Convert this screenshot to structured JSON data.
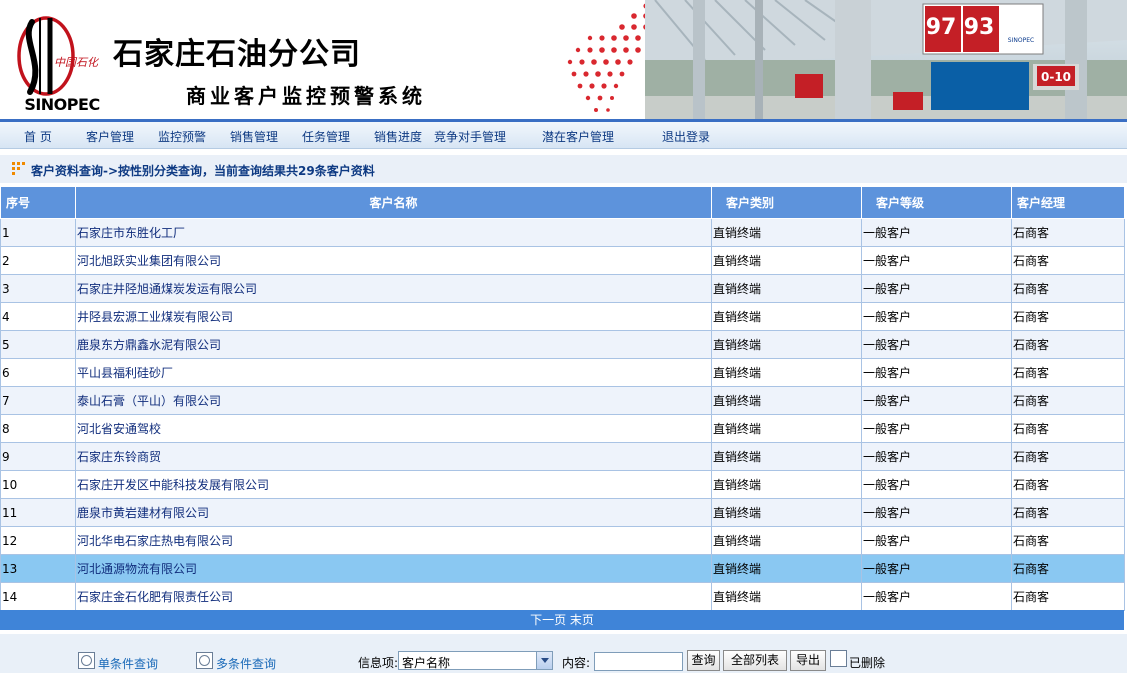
{
  "header": {
    "company_name": "石家庄石油分公司",
    "system_name": "商业客户监控预警系统",
    "logo_text": "中国石化",
    "logo_wordmark": "SINOPEC",
    "banner_price_1": "97",
    "banner_price_2": "93",
    "banner_brand": "SINOPEC",
    "banner_sign": "0-10"
  },
  "nav": {
    "items": [
      "首 页",
      "客户管理",
      "监控预警",
      "销售管理",
      "任务管理",
      "销售进度",
      "竞争对手管理",
      "潜在客户管理",
      "退出登录"
    ]
  },
  "breadcrumb": {
    "text": "客户资料查询->按性别分类查询，当前查询结果共29条客户资料"
  },
  "table": {
    "columns": [
      "序号",
      "客户名称",
      "客户类别",
      "客户等级",
      "客户经理"
    ],
    "rows": [
      [
        "1",
        "石家庄市东胜化工厂",
        "直销终端",
        "一般客户",
        "石商客"
      ],
      [
        "2",
        "河北旭跃实业集团有限公司",
        "直销终端",
        "一般客户",
        "石商客"
      ],
      [
        "3",
        "石家庄井陉旭通煤炭发运有限公司",
        "直销终端",
        "一般客户",
        "石商客"
      ],
      [
        "4",
        "井陉县宏源工业煤炭有限公司",
        "直销终端",
        "一般客户",
        "石商客"
      ],
      [
        "5",
        "鹿泉东方鼎鑫水泥有限公司",
        "直销终端",
        "一般客户",
        "石商客"
      ],
      [
        "6",
        "平山县福利硅砂厂",
        "直销终端",
        "一般客户",
        "石商客"
      ],
      [
        "7",
        "泰山石膏（平山）有限公司",
        "直销终端",
        "一般客户",
        "石商客"
      ],
      [
        "8",
        "河北省安通驾校",
        "直销终端",
        "一般客户",
        "石商客"
      ],
      [
        "9",
        "石家庄东铃商贸",
        "直销终端",
        "一般客户",
        "石商客"
      ],
      [
        "10",
        "石家庄开发区中能科技发展有限公司",
        "直销终端",
        "一般客户",
        "石商客"
      ],
      [
        "11",
        "鹿泉市黄岩建材有限公司",
        "直销终端",
        "一般客户",
        "石商客"
      ],
      [
        "12",
        "河北华电石家庄热电有限公司",
        "直销终端",
        "一般客户",
        "石商客"
      ],
      [
        "13",
        "河北通源物流有限公司",
        "直销终端",
        "一般客户",
        "石商客"
      ],
      [
        "14",
        "石家庄金石化肥有限责任公司",
        "直销终端",
        "一般客户",
        "石商客"
      ]
    ],
    "selected_row": 13
  },
  "pager": {
    "next_page": "下一页",
    "last_page": "末页"
  },
  "search": {
    "single_label": "单条件查询",
    "multi_label": "多条件查询",
    "field_label": "信息项:",
    "field_value": "客户名称",
    "content_label": "内容:",
    "content_value": "",
    "query_button": "查询",
    "list_all_button": "全部列表",
    "export_button": "导出",
    "deleted_label": "已删除"
  },
  "colors": {
    "table_header": "#5d93dc",
    "selected_row": "#8ac8f2",
    "pager": "#3f84d8",
    "nav_text": "#0e3a83"
  }
}
